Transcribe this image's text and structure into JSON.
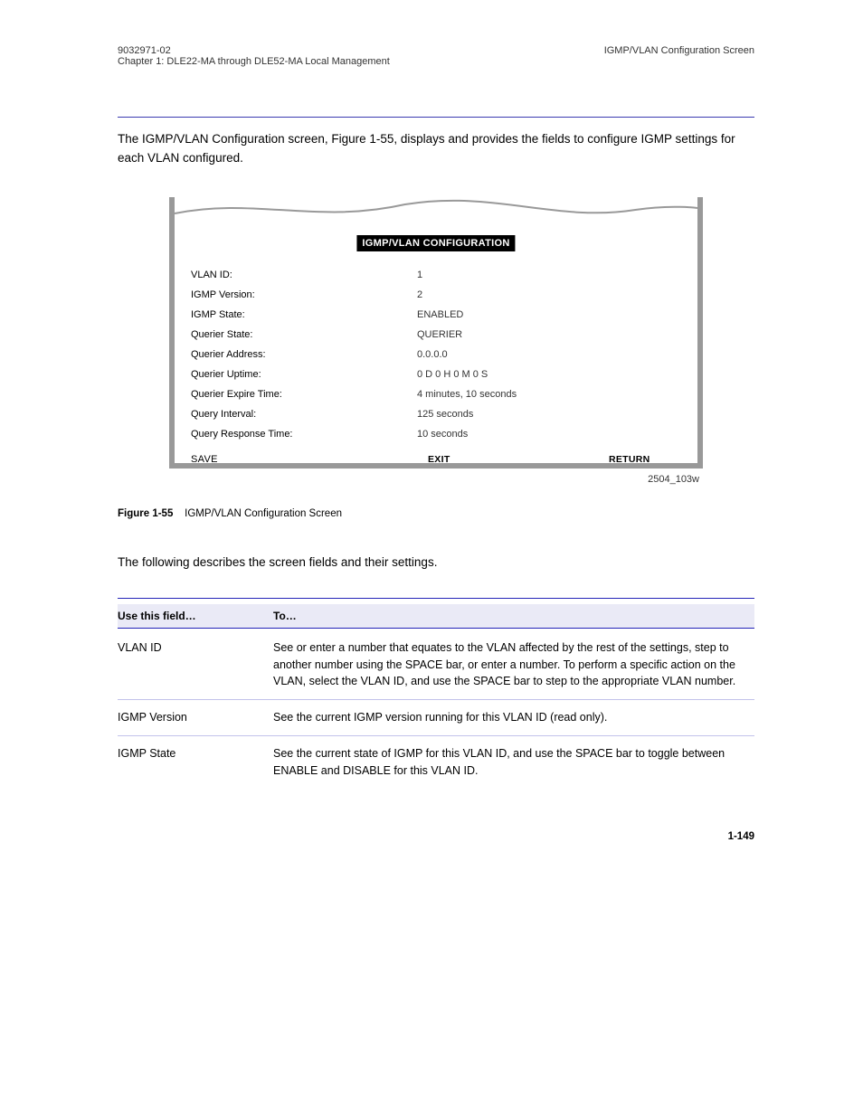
{
  "header": {
    "left1": "9032971-02",
    "left2": "Chapter 1: DLE22-MA through DLE52-MA Local Management",
    "right": "IGMP/VLAN Configuration Screen"
  },
  "intro": "The IGMP/VLAN Configuration screen, Figure 1-55, displays and provides the fields to configure IGMP settings for each VLAN configured.",
  "figure": {
    "title": "IGMP/VLAN CONFIGURATION",
    "rows": [
      {
        "label": "VLAN ID:",
        "value": "1"
      },
      {
        "label": "IGMP Version:",
        "value": "2"
      },
      {
        "label": "IGMP State:",
        "value": "ENABLED"
      },
      {
        "label": "Querier State:",
        "value": "QUERIER"
      },
      {
        "label": "Querier Address:",
        "value": "0.0.0.0"
      },
      {
        "label": "Querier Uptime:",
        "value": "0 D 0 H 0 M 0 S"
      },
      {
        "label": "Querier Expire Time:",
        "value": "4 minutes, 10 seconds"
      },
      {
        "label": "Query Interval:",
        "value": "125 seconds"
      },
      {
        "label": "Query Response Time:",
        "value": "10 seconds"
      }
    ],
    "save": "SAVE",
    "exit": "EXIT",
    "ret": "RETURN",
    "code": "2504_103w"
  },
  "caption": {
    "figlabel": "Figure 1-55",
    "title": "IGMP/VLAN Configuration Screen"
  },
  "sectIntro": "The following describes the screen fields and their settings.",
  "table": {
    "colA": "Use this field…",
    "colB": "To…",
    "rows": [
      {
        "a": "VLAN ID",
        "b": "See or enter a number that equates to the VLAN affected by the rest of the settings, step to another number using the SPACE bar, or enter a number. To perform a specific action on the VLAN, select the VLAN ID, and use the SPACE bar to step to the appropriate VLAN number."
      },
      {
        "a": "IGMP Version",
        "b": "See the current IGMP version running for this VLAN ID (read only)."
      },
      {
        "a": "IGMP State",
        "b": "See the current state of IGMP for this VLAN ID, and use the SPACE bar to toggle between ENABLE and DISABLE for this VLAN ID."
      }
    ]
  },
  "pagenum": "1-149"
}
